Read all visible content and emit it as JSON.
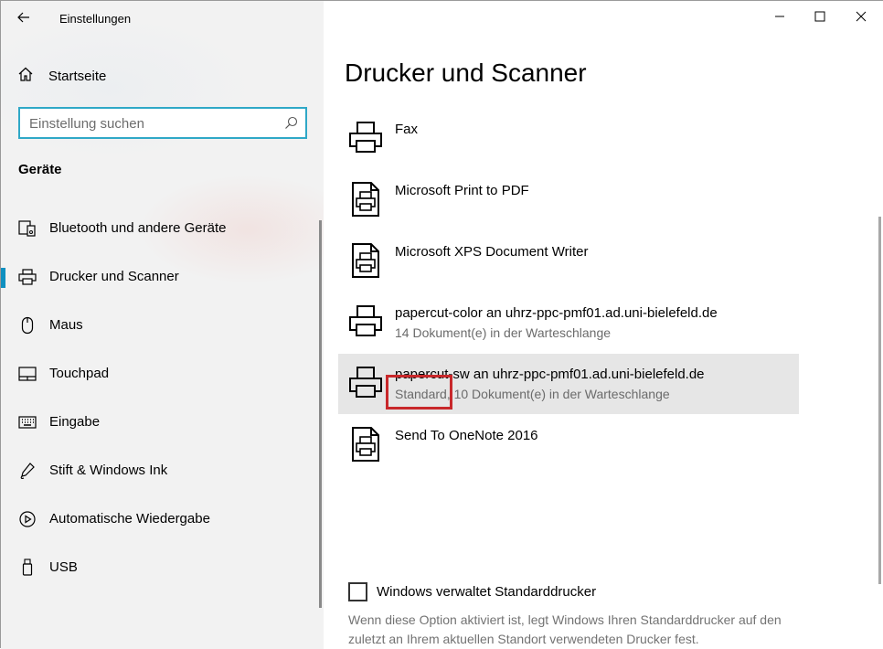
{
  "window": {
    "title": "Einstellungen"
  },
  "sidebar": {
    "home_label": "Startseite",
    "search_placeholder": "Einstellung suchen",
    "section_title": "Geräte",
    "items": [
      {
        "label": "Bluetooth und andere Geräte",
        "icon": "bluetooth-devices-icon"
      },
      {
        "label": "Drucker und Scanner",
        "icon": "printer-icon",
        "selected": true
      },
      {
        "label": "Maus",
        "icon": "mouse-icon"
      },
      {
        "label": "Touchpad",
        "icon": "touchpad-icon"
      },
      {
        "label": "Eingabe",
        "icon": "keyboard-icon"
      },
      {
        "label": "Stift & Windows Ink",
        "icon": "pen-icon"
      },
      {
        "label": "Automatische Wiedergabe",
        "icon": "autoplay-icon"
      },
      {
        "label": "USB",
        "icon": "usb-icon"
      }
    ]
  },
  "main": {
    "page_title": "Drucker und Scanner",
    "printers": [
      {
        "name": "Fax",
        "status": "",
        "icon": "printer-icon"
      },
      {
        "name": "Microsoft Print to PDF",
        "status": "",
        "icon": "document-printer-icon"
      },
      {
        "name": "Microsoft XPS Document Writer",
        "status": "",
        "icon": "document-printer-icon"
      },
      {
        "name": "papercut-color an uhrz-ppc-pmf01.ad.uni-bielefeld.de",
        "status": "14 Dokument(e) in der Warteschlange",
        "icon": "printer-icon"
      },
      {
        "name": "papercut-sw an uhrz-ppc-pmf01.ad.uni-bielefeld.de",
        "status": "Standard, 10 Dokument(e) in der Warteschlange",
        "icon": "printer-icon",
        "selected": true
      },
      {
        "name": "Send To OneNote 2016",
        "status": "",
        "icon": "document-printer-icon"
      }
    ],
    "default_checkbox": {
      "label": "Windows verwaltet Standarddrucker",
      "checked": false,
      "description": "Wenn diese Option aktiviert ist, legt Windows Ihren Standarddrucker auf den zuletzt an Ihrem aktuellen Standort verwendeten Drucker fest."
    }
  },
  "colors": {
    "accent": "#0f90c0",
    "search_border": "#2fa8c7",
    "highlight_box": "#c8282b",
    "selected_row": "#e6e6e6"
  }
}
